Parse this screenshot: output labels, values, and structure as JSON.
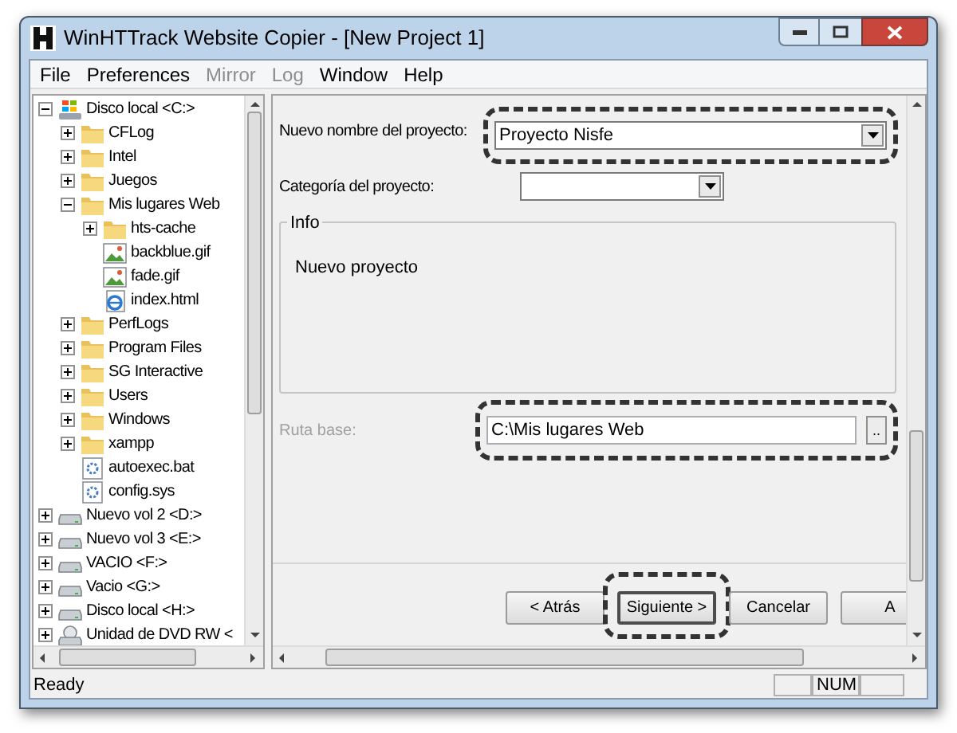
{
  "window": {
    "title": "WinHTTrack Website Copier - [New Project 1]"
  },
  "menu": [
    {
      "label": "File",
      "disabled": false
    },
    {
      "label": "Preferences",
      "disabled": false
    },
    {
      "label": "Mirror",
      "disabled": true
    },
    {
      "label": "Log",
      "disabled": true
    },
    {
      "label": "Window",
      "disabled": false
    },
    {
      "label": "Help",
      "disabled": false
    }
  ],
  "tree": [
    {
      "label": "Disco local <C:>",
      "kind": "system-drive",
      "expanded": true,
      "children": [
        {
          "label": "CFLog",
          "kind": "folder",
          "expanded": false
        },
        {
          "label": "Intel",
          "kind": "folder",
          "expanded": false
        },
        {
          "label": "Juegos",
          "kind": "folder",
          "expanded": false
        },
        {
          "label": "Mis lugares Web",
          "kind": "folder",
          "expanded": true,
          "children": [
            {
              "label": "hts-cache",
              "kind": "folder",
              "expanded": false
            },
            {
              "label": "backblue.gif",
              "kind": "image"
            },
            {
              "label": "fade.gif",
              "kind": "image"
            },
            {
              "label": "index.html",
              "kind": "html"
            }
          ]
        },
        {
          "label": "PerfLogs",
          "kind": "folder",
          "expanded": false
        },
        {
          "label": "Program Files",
          "kind": "folder",
          "expanded": false
        },
        {
          "label": "SG Interactive",
          "kind": "folder",
          "expanded": false
        },
        {
          "label": "Users",
          "kind": "folder",
          "expanded": false
        },
        {
          "label": "Windows",
          "kind": "folder",
          "expanded": false
        },
        {
          "label": "xampp",
          "kind": "folder",
          "expanded": false
        },
        {
          "label": "autoexec.bat",
          "kind": "system-file"
        },
        {
          "label": "config.sys",
          "kind": "system-file"
        }
      ]
    },
    {
      "label": "Nuevo vol 2 <D:>",
      "kind": "drive",
      "expanded": false
    },
    {
      "label": "Nuevo vol 3 <E:>",
      "kind": "drive",
      "expanded": false
    },
    {
      "label": "VACIO <F:>",
      "kind": "drive",
      "expanded": false
    },
    {
      "label": "Vacio <G:>",
      "kind": "drive",
      "expanded": false
    },
    {
      "label": "Disco local <H:>",
      "kind": "drive",
      "expanded": false
    },
    {
      "label": "Unidad de DVD RW <",
      "kind": "dvd",
      "expanded": false
    }
  ],
  "form": {
    "project_name": {
      "label": "Nuevo nombre del proyecto:",
      "value": "Proyecto Nisfe"
    },
    "category": {
      "label": "Categoría del proyecto:"
    },
    "info": {
      "title": "Info",
      "text": "Nuevo proyecto"
    },
    "base_path": {
      "label": "Ruta base:",
      "value": "C:\\Mis lugares Web",
      "disabled": true,
      "browse": ".."
    }
  },
  "buttons": [
    {
      "label": "< Atrás",
      "default": false
    },
    {
      "label": "Siguiente >",
      "default": true
    },
    {
      "label": "Cancelar",
      "default": false
    },
    {
      "label": "A",
      "default": false
    }
  ],
  "status_bar": {
    "text": "Ready",
    "indicator": "NUM"
  }
}
